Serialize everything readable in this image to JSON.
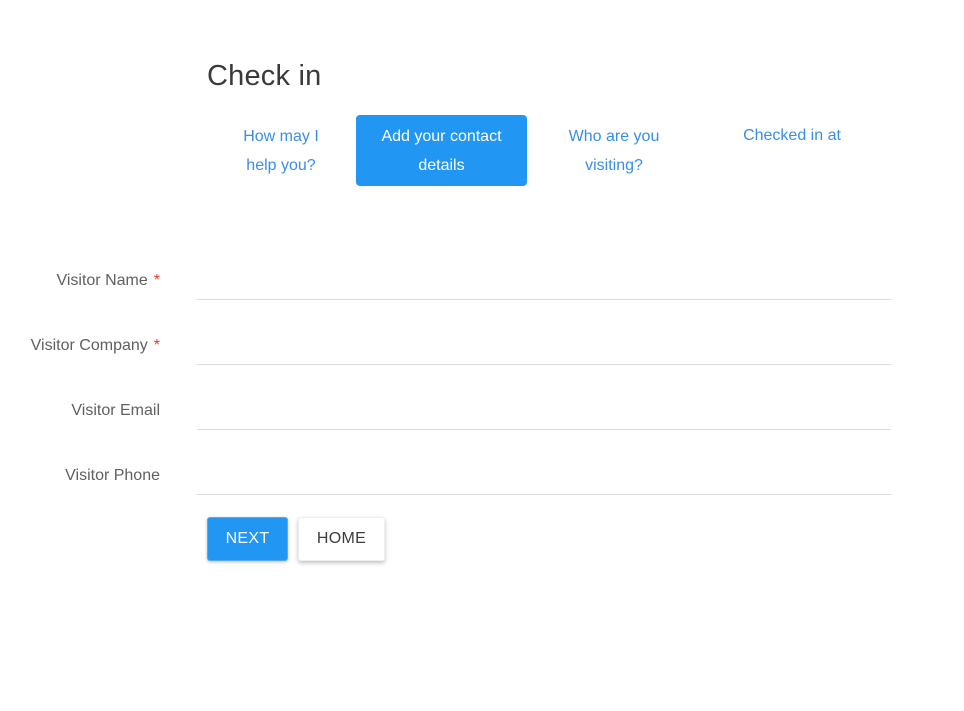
{
  "page": {
    "title": "Check in"
  },
  "steps": [
    {
      "line1": "How may I",
      "line2": "help you?",
      "active": false
    },
    {
      "line1": "Add your contact",
      "line2": "details",
      "active": true
    },
    {
      "line1": "Who are you",
      "line2": "visiting?",
      "active": false
    },
    {
      "line1": "Checked in at",
      "line2": "",
      "active": false
    }
  ],
  "form": {
    "fields": [
      {
        "label": "Visitor Name",
        "required": true,
        "required_mark": "*",
        "value": "",
        "placeholder": ""
      },
      {
        "label": "Visitor Company",
        "required": true,
        "required_mark": "*",
        "value": "",
        "placeholder": ""
      },
      {
        "label": "Visitor Email",
        "required": false,
        "value": "",
        "placeholder": ""
      },
      {
        "label": "Visitor Phone",
        "required": false,
        "value": "",
        "placeholder": ""
      }
    ]
  },
  "buttons": {
    "next_label": "NEXT",
    "home_label": "HOME"
  },
  "colors": {
    "accent": "#2196f3",
    "step_link": "#3a8ee6",
    "required": "#e53935",
    "label_text": "#5f6062"
  }
}
